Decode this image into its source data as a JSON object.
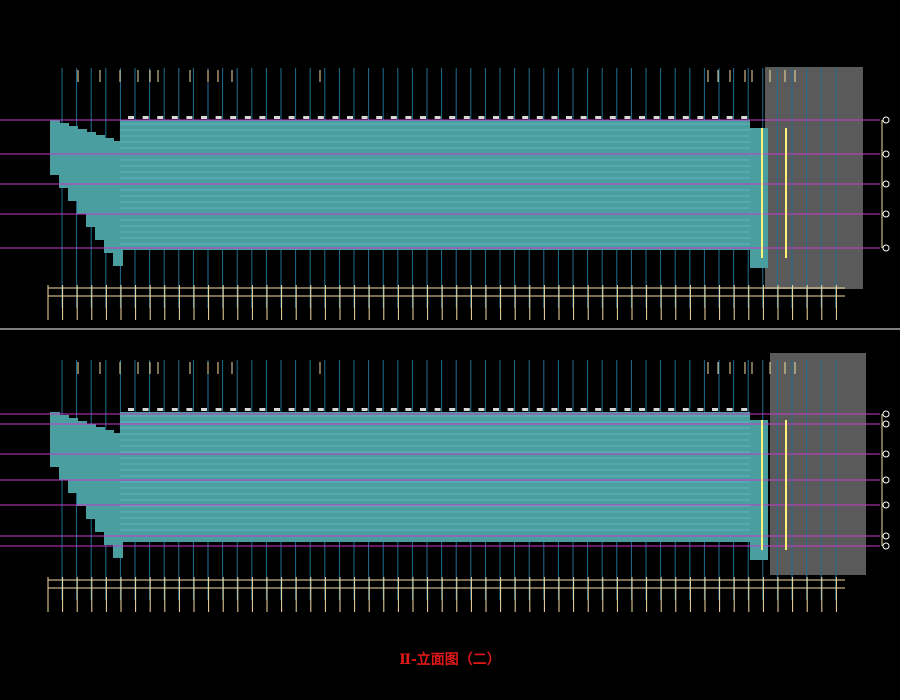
{
  "drawing": {
    "title": "Ⅱ-立面图（二）",
    "colors": {
      "background": "#000000",
      "facade_fill": "#4a9ea0",
      "facade_panel": "#5fb6b8",
      "grid_line": "#1e6f93",
      "dimension": "#f6dda2",
      "level_line": "#c838c8",
      "shade": "#5a5a5a",
      "separator": "#ffffff",
      "title": "#e01818",
      "highlight": "#fff27a"
    },
    "elevations": [
      {
        "name": "upper-elevation"
      },
      {
        "name": "lower-elevation"
      }
    ]
  }
}
